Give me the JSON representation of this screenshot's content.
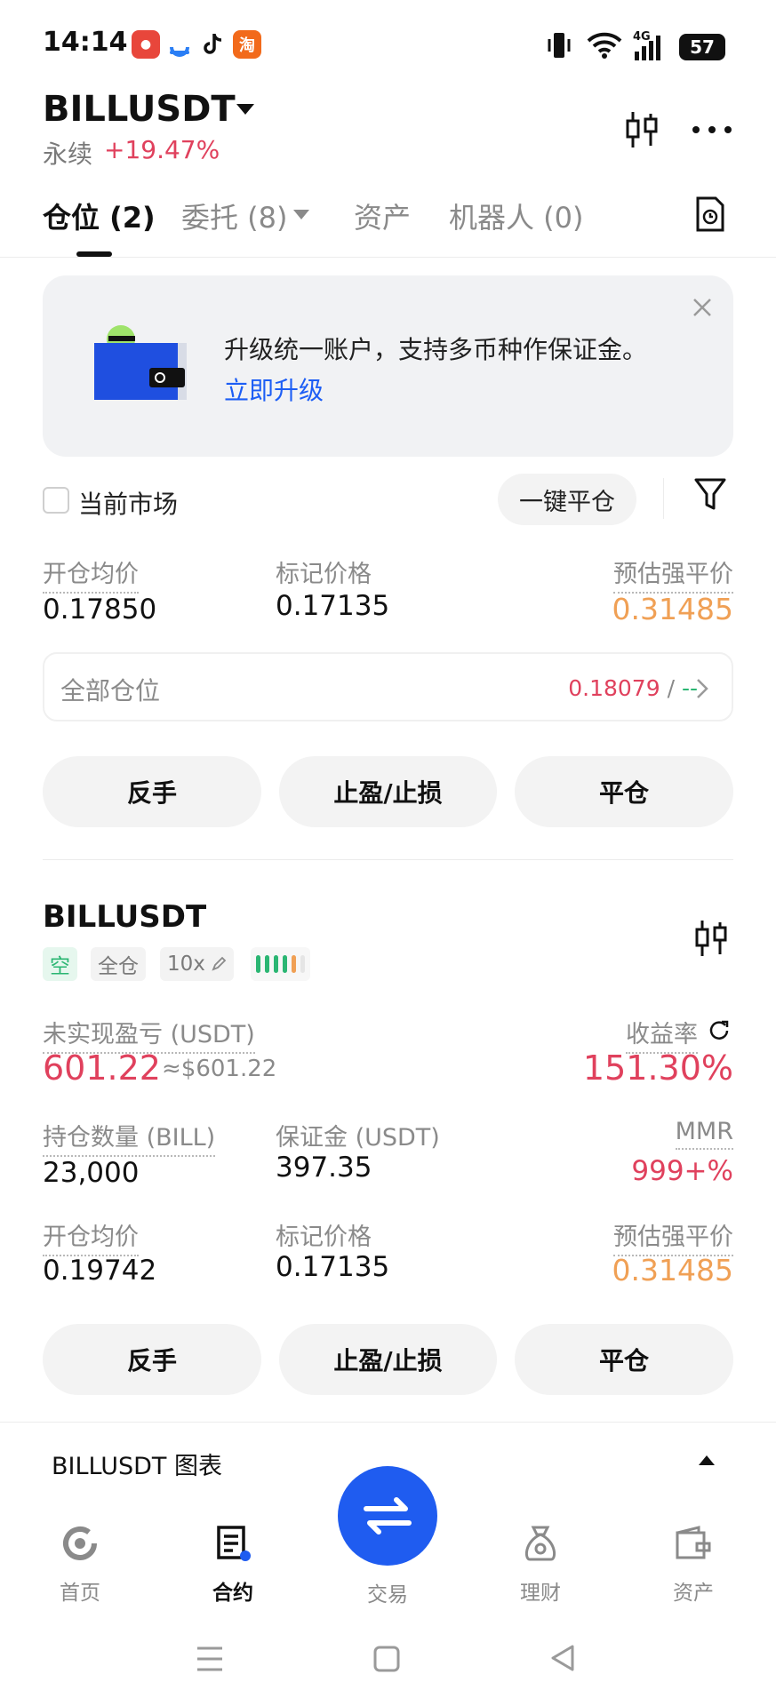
{
  "status_bar": {
    "time": "14:14",
    "battery": "57",
    "network": "4G",
    "app_icons": [
      "app-icon-red",
      "app-icon-blue",
      "tiktok-icon",
      "taobao-icon"
    ]
  },
  "header": {
    "pair": "BILLUSDT",
    "contract_type": "永续",
    "change": "+19.47%"
  },
  "tabs": [
    {
      "label": "仓位 (2)",
      "active": true
    },
    {
      "label": "委托 (8)",
      "active": false
    },
    {
      "label": "资产",
      "active": false
    },
    {
      "label": "机器人 (0)",
      "active": false
    }
  ],
  "banner": {
    "text": "升级统一账户，支持多币种作保证金。",
    "link": "立即升级"
  },
  "filter_row": {
    "checkbox_label": "当前市场",
    "close_all": "一键平仓"
  },
  "summary": {
    "avg_open_label": "开仓均价",
    "avg_open_value": "0.17850",
    "mark_label": "标记价格",
    "mark_value": "0.17135",
    "liq_label": "预估强平价",
    "liq_value": "0.31485"
  },
  "all_positions": {
    "label": "全部仓位",
    "value": "0.18079",
    "separator": "/",
    "value2": "--"
  },
  "actions": {
    "reverse": "反手",
    "tpsl": "止盈/止损",
    "close": "平仓"
  },
  "position": {
    "symbol": "BILLUSDT",
    "side": "空",
    "margin_mode": "全仓",
    "leverage": "10x",
    "upnl_label": "未实现盈亏 (USDT)",
    "upnl_value": "601.22",
    "upnl_usd": "≈$601.22",
    "roe_label": "收益率",
    "roe_value": "151.30%",
    "size_label": "持仓数量 (BILL)",
    "size_value": "23,000",
    "margin_label": "保证金 (USDT)",
    "margin_value": "397.35",
    "mmr_label": "MMR",
    "mmr_value": "999+%",
    "avg_open_label": "开仓均价",
    "avg_open_value": "0.19742",
    "mark_label": "标记价格",
    "mark_value": "0.17135",
    "liq_label": "预估强平价",
    "liq_value": "0.31485"
  },
  "chart_bar": {
    "label": "BILLUSDT 图表"
  },
  "bottom_nav": [
    {
      "label": "首页",
      "active": false
    },
    {
      "label": "合约",
      "active": true
    },
    {
      "label": "交易",
      "active": false
    },
    {
      "label": "理财",
      "active": false
    },
    {
      "label": "资产",
      "active": false
    }
  ],
  "colors": {
    "accent_blue": "#1f5cf0",
    "red": "#e0415d",
    "green": "#2bb673",
    "orange": "#f0a055"
  }
}
